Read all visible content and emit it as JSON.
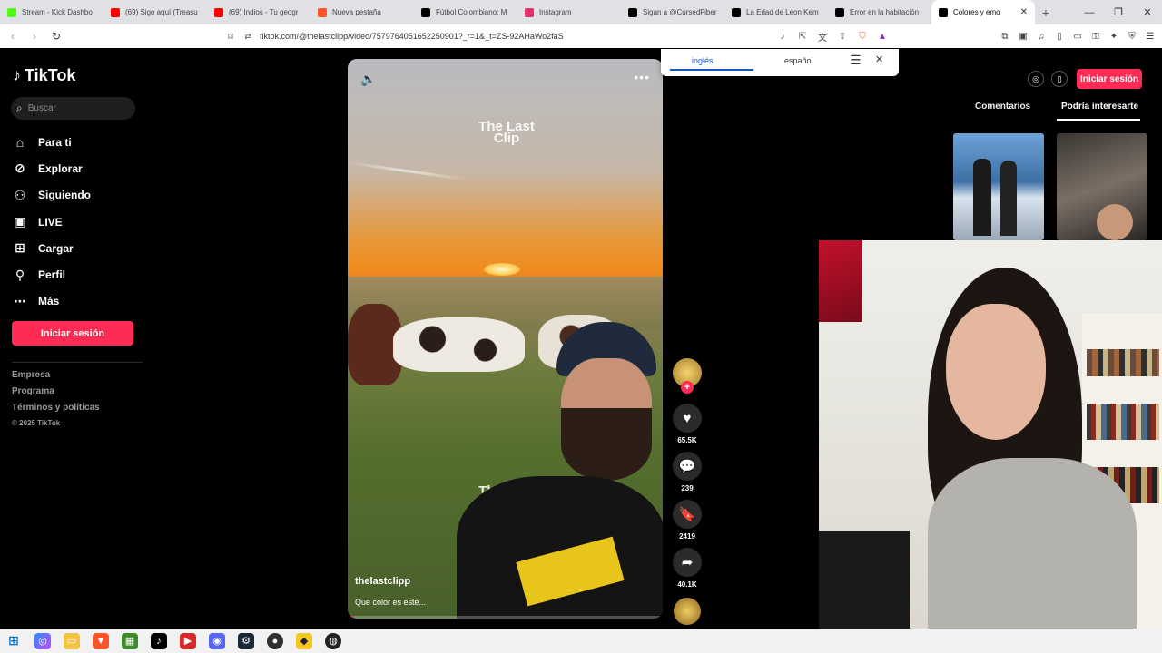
{
  "browser": {
    "tabs": [
      {
        "title": "Stream - Kick Dashbo",
        "icon": "kick-icon",
        "color": "#53fc18"
      },
      {
        "title": "(69) Sigo aquí (Treasu",
        "icon": "youtube-icon",
        "color": "#ff0000"
      },
      {
        "title": "(69) Indios - Tu geogr",
        "icon": "youtube-icon",
        "color": "#ff0000"
      },
      {
        "title": "Nueva pestaña",
        "icon": "brave-icon",
        "color": "#fb542b"
      },
      {
        "title": "Fútbol Colombiano: M",
        "icon": "tiktok-icon",
        "color": "#000000"
      },
      {
        "title": "Instagram",
        "icon": "instagram-icon",
        "color": "#e1306c"
      },
      {
        "title": "Sigan a @CursedFiber",
        "icon": "tiktok-icon",
        "color": "#000000"
      },
      {
        "title": "La Edad de Leon Kem",
        "icon": "tiktok-icon",
        "color": "#000000"
      },
      {
        "title": "Error en la habitación",
        "icon": "tiktok-icon",
        "color": "#000000"
      },
      {
        "title": "Colores y emo",
        "icon": "tiktok-icon",
        "color": "#000000",
        "active": true
      }
    ],
    "url": "tiktok.com/@thelastclipp/video/7579764051652250901?_r=1&_t=ZS-92AHaWo2faS"
  },
  "translate_popup": {
    "source_lang": "inglés",
    "target_lang": "español"
  },
  "sidebar": {
    "logo": "TikTok",
    "search_placeholder": "Buscar",
    "nav": [
      {
        "label": "Para ti",
        "icon": "home-icon"
      },
      {
        "label": "Explorar",
        "icon": "compass-icon"
      },
      {
        "label": "Siguiendo",
        "icon": "following-icon"
      },
      {
        "label": "LIVE",
        "icon": "live-icon"
      },
      {
        "label": "Cargar",
        "icon": "upload-icon"
      },
      {
        "label": "Perfil",
        "icon": "profile-icon"
      },
      {
        "label": "Más",
        "icon": "more-icon"
      }
    ],
    "login_button": "Iniciar sesión",
    "footer": [
      "Empresa",
      "Programa",
      "Términos y políticas"
    ],
    "copyright": "© 2025 TikTok"
  },
  "video": {
    "watermark": "The Last Clip",
    "author": "thelastclipp",
    "caption": "Que color es este...",
    "progress": 0.02
  },
  "actions": {
    "likes": "65.5K",
    "comments": "239",
    "saves": "2419",
    "shares": "40.1K"
  },
  "right_panel": {
    "login_button": "Iniciar sesión",
    "tab_comments": "Comentarios",
    "tab_related": "Podría interesarte"
  },
  "colors": {
    "accent": "#fe2c55"
  }
}
